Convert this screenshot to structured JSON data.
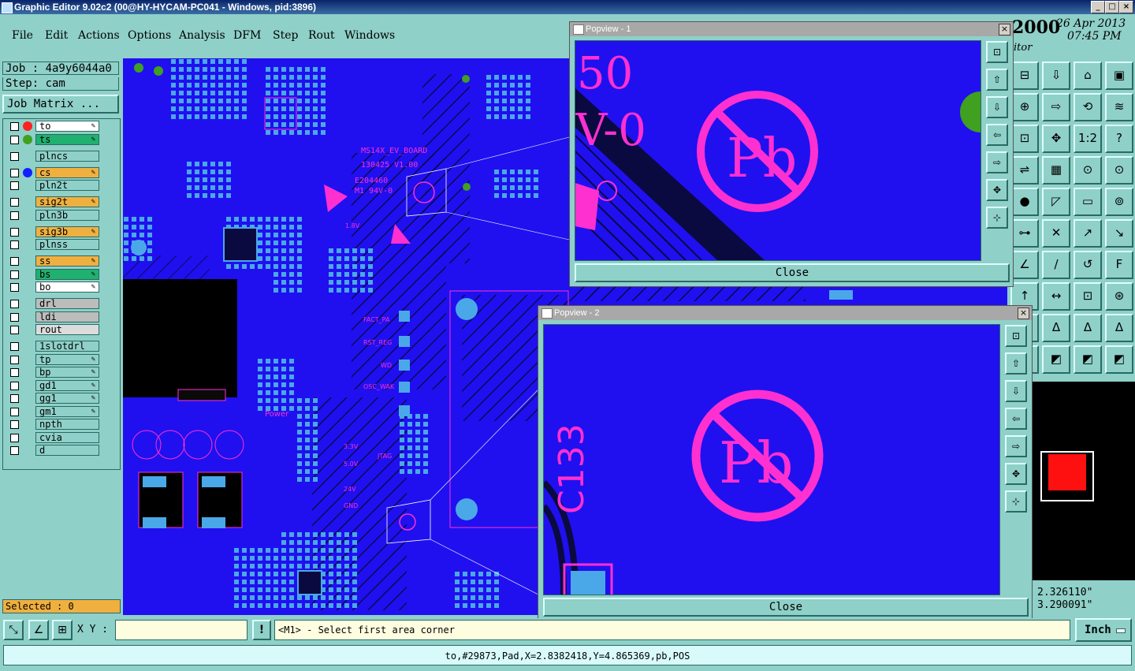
{
  "window": {
    "title": "Graphic Editor 9.02c2 (00@HY-HYCAM-PC041 - Windows, pid:3896)"
  },
  "menu": [
    "File",
    "Edit",
    "Actions",
    "Options",
    "Analysis",
    "DFM",
    "Step",
    "Rout",
    "Windows"
  ],
  "job": {
    "job_label": "Job : 4a9y6044a0",
    "step_label": "Step: cam",
    "matrix_button": "Job Matrix ..."
  },
  "layers": [
    {
      "name": "to",
      "color": "#ffffff",
      "dot": "#ff2020"
    },
    {
      "name": "ts",
      "color": "#20b070",
      "dot": "#40a020"
    },
    {
      "name": "plncs",
      "color": "#8fd0c8",
      "dot": ""
    },
    {
      "name": "cs",
      "color": "#f0b040",
      "dot": "#1020ff"
    },
    {
      "name": "pln2t",
      "color": "#8fd0c8",
      "dot": ""
    },
    {
      "name": "sig2t",
      "color": "#f0b040",
      "dot": ""
    },
    {
      "name": "pln3b",
      "color": "#8fd0c8",
      "dot": ""
    },
    {
      "name": "sig3b",
      "color": "#f0b040",
      "dot": ""
    },
    {
      "name": "plnss",
      "color": "#8fd0c8",
      "dot": ""
    },
    {
      "name": "ss",
      "color": "#f0b040",
      "dot": ""
    },
    {
      "name": "bs",
      "color": "#20b070",
      "dot": ""
    },
    {
      "name": "bo",
      "color": "#ffffff",
      "dot": ""
    },
    {
      "name": "drl",
      "color": "#bcbcbc",
      "dot": ""
    },
    {
      "name": "ldi",
      "color": "#bcbcbc",
      "dot": ""
    },
    {
      "name": "rout",
      "color": "#dcdcdc",
      "dot": ""
    },
    {
      "name": "1slotdrl",
      "color": "#8fd0c8",
      "dot": ""
    },
    {
      "name": "tp",
      "color": "#8fd0c8",
      "dot": ""
    },
    {
      "name": "bp",
      "color": "#8fd0c8",
      "dot": ""
    },
    {
      "name": "gd1",
      "color": "#8fd0c8",
      "dot": ""
    },
    {
      "name": "gg1",
      "color": "#8fd0c8",
      "dot": ""
    },
    {
      "name": "gm1",
      "color": "#8fd0c8",
      "dot": ""
    },
    {
      "name": "npth",
      "color": "#8fd0c8",
      "dot": ""
    },
    {
      "name": "cvia",
      "color": "#8fd0c8",
      "dot": ""
    },
    {
      "name": "d",
      "color": "#8fd0c8",
      "dot": ""
    }
  ],
  "selected": "Selected : 0",
  "header_right": {
    "brand": "2000",
    "date": "26 Apr 2013",
    "time": "07:45 PM",
    "subtitle": "itor"
  },
  "popview1": {
    "title": "Popview - 1",
    "close": "Close",
    "text_a": "50",
    "text_b": "V-0"
  },
  "popview2": {
    "title": "Popview - 2",
    "close": "Close",
    "text_a": "C133"
  },
  "board_text": {
    "name": "MS14X_EV_BOARD",
    "version": "130425 V1.00",
    "code": "E204460",
    "rating": "M1 94V-0",
    "fact_pa": "FACT_PA",
    "rst_reg": "RST_REG",
    "wd": "WD",
    "osc_wak": "OSC_WAK",
    "jtag": "JTAG",
    "power": "Power",
    "v33": "3.3V",
    "v50": "5.0V",
    "v24": "24V",
    "gnd": "GND",
    "v18": "1.8V"
  },
  "coords": {
    "x": "2.326110\"",
    "y": "3.290091\""
  },
  "bottom": {
    "xy_label": "X Y :",
    "xy_value": "",
    "prompt": "<M1> - Select first area corner",
    "units": "Inch",
    "warn": "!"
  },
  "status": "to,#29873,Pad,X=2.8382418,Y=4.865369,pb,POS",
  "colors": {
    "board": "#2010f0",
    "pad": "#4aa8e8",
    "silk": "#ff30d0",
    "panel": "#8fd0c8"
  }
}
